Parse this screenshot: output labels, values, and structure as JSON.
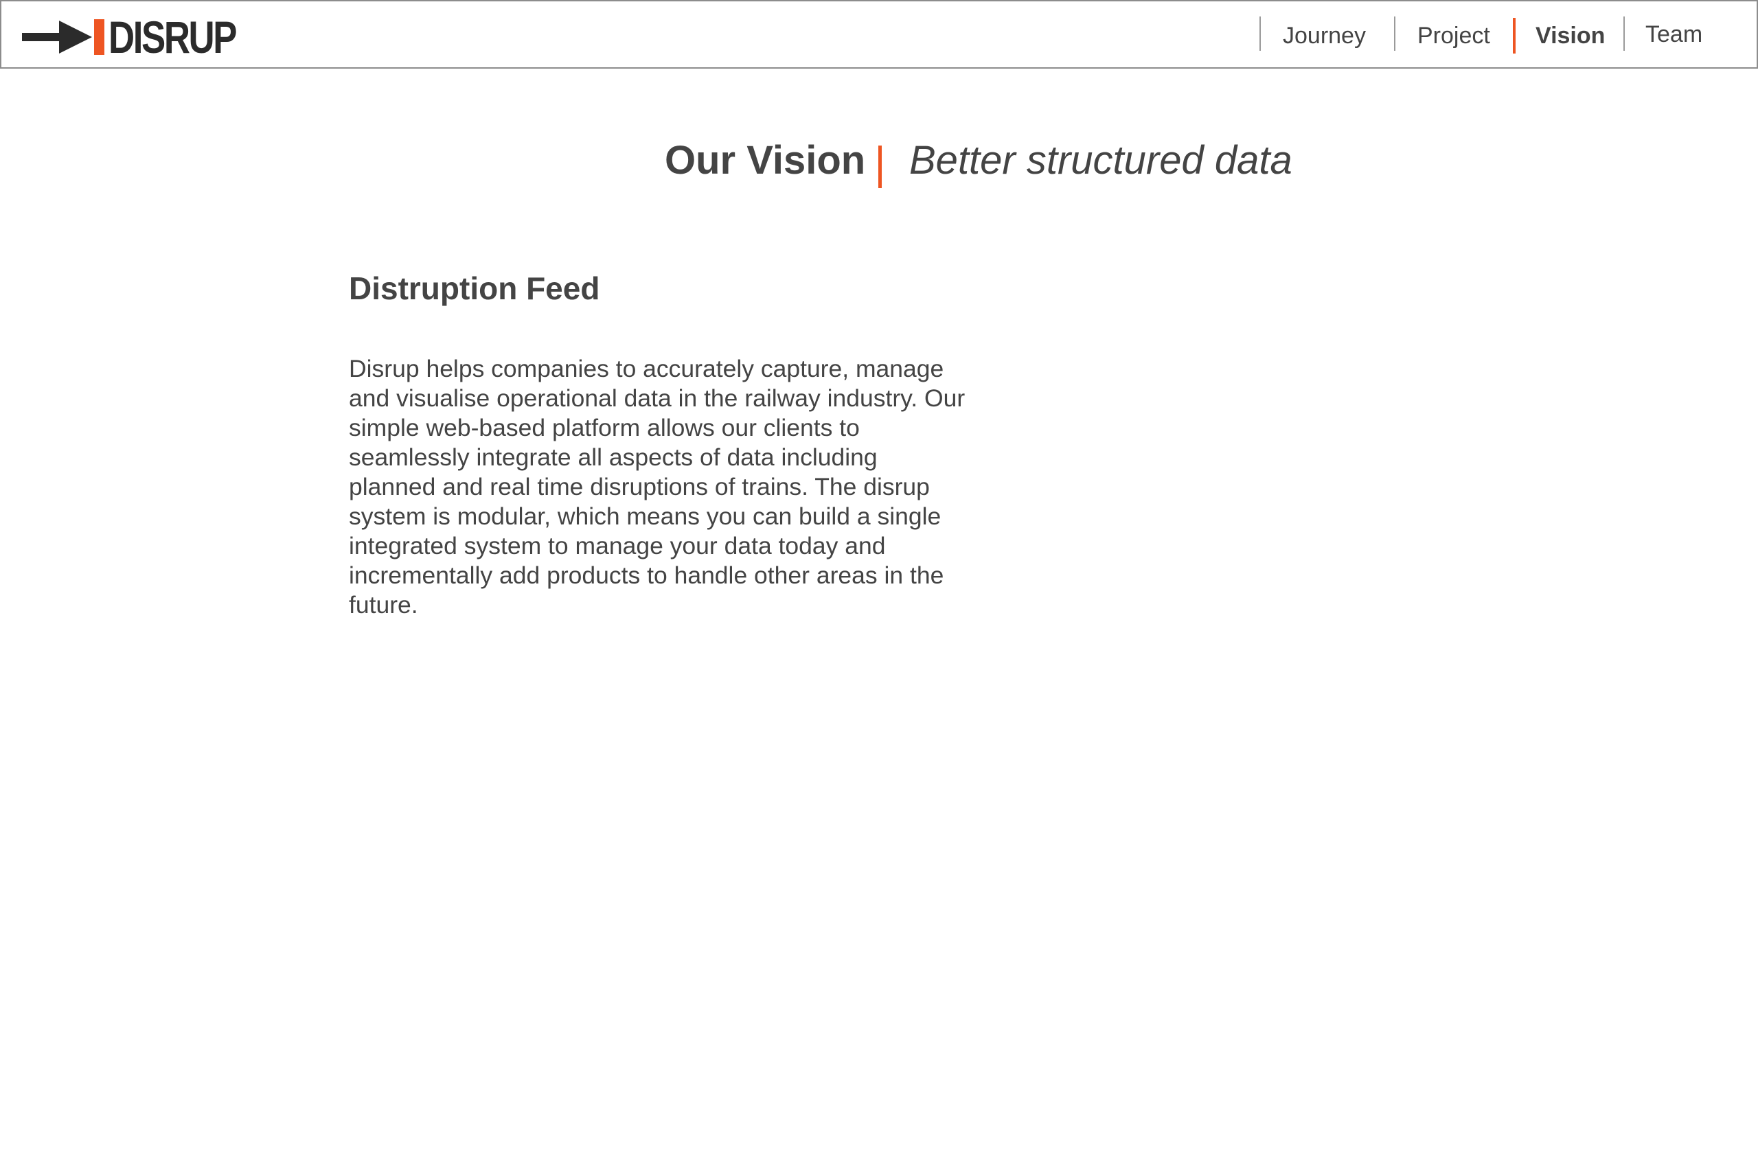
{
  "header": {
    "logo": {
      "text": "DISRUP",
      "icon": "arrow-right-icon",
      "accent_color": "#ee5522",
      "text_color": "#2b2b2b"
    },
    "nav": {
      "items": [
        {
          "label": "Journey",
          "active": false
        },
        {
          "label": "Project",
          "active": false
        },
        {
          "label": "Vision",
          "active": true
        },
        {
          "label": "Team",
          "active": false
        }
      ],
      "active_color": "#ee5522",
      "separator_color": "#9a9a9a"
    }
  },
  "hero": {
    "title": "Our Vision",
    "subtitle": "Better structured data"
  },
  "section": {
    "heading": "Distruption Feed",
    "body": "Disrup helps companies to accurately capture, manage and visualise operational data in the railway industry. Our simple web-based platform allows our clients to seamlessly integrate all aspects of data including planned and real time disruptions of trains. The disrup system is modular, which means you can build a single integrated system to manage your data today and incrementally add products to handle other areas in the future."
  },
  "colors": {
    "text": "#444444",
    "border": "#8c8c8c",
    "background": "#ffffff"
  }
}
